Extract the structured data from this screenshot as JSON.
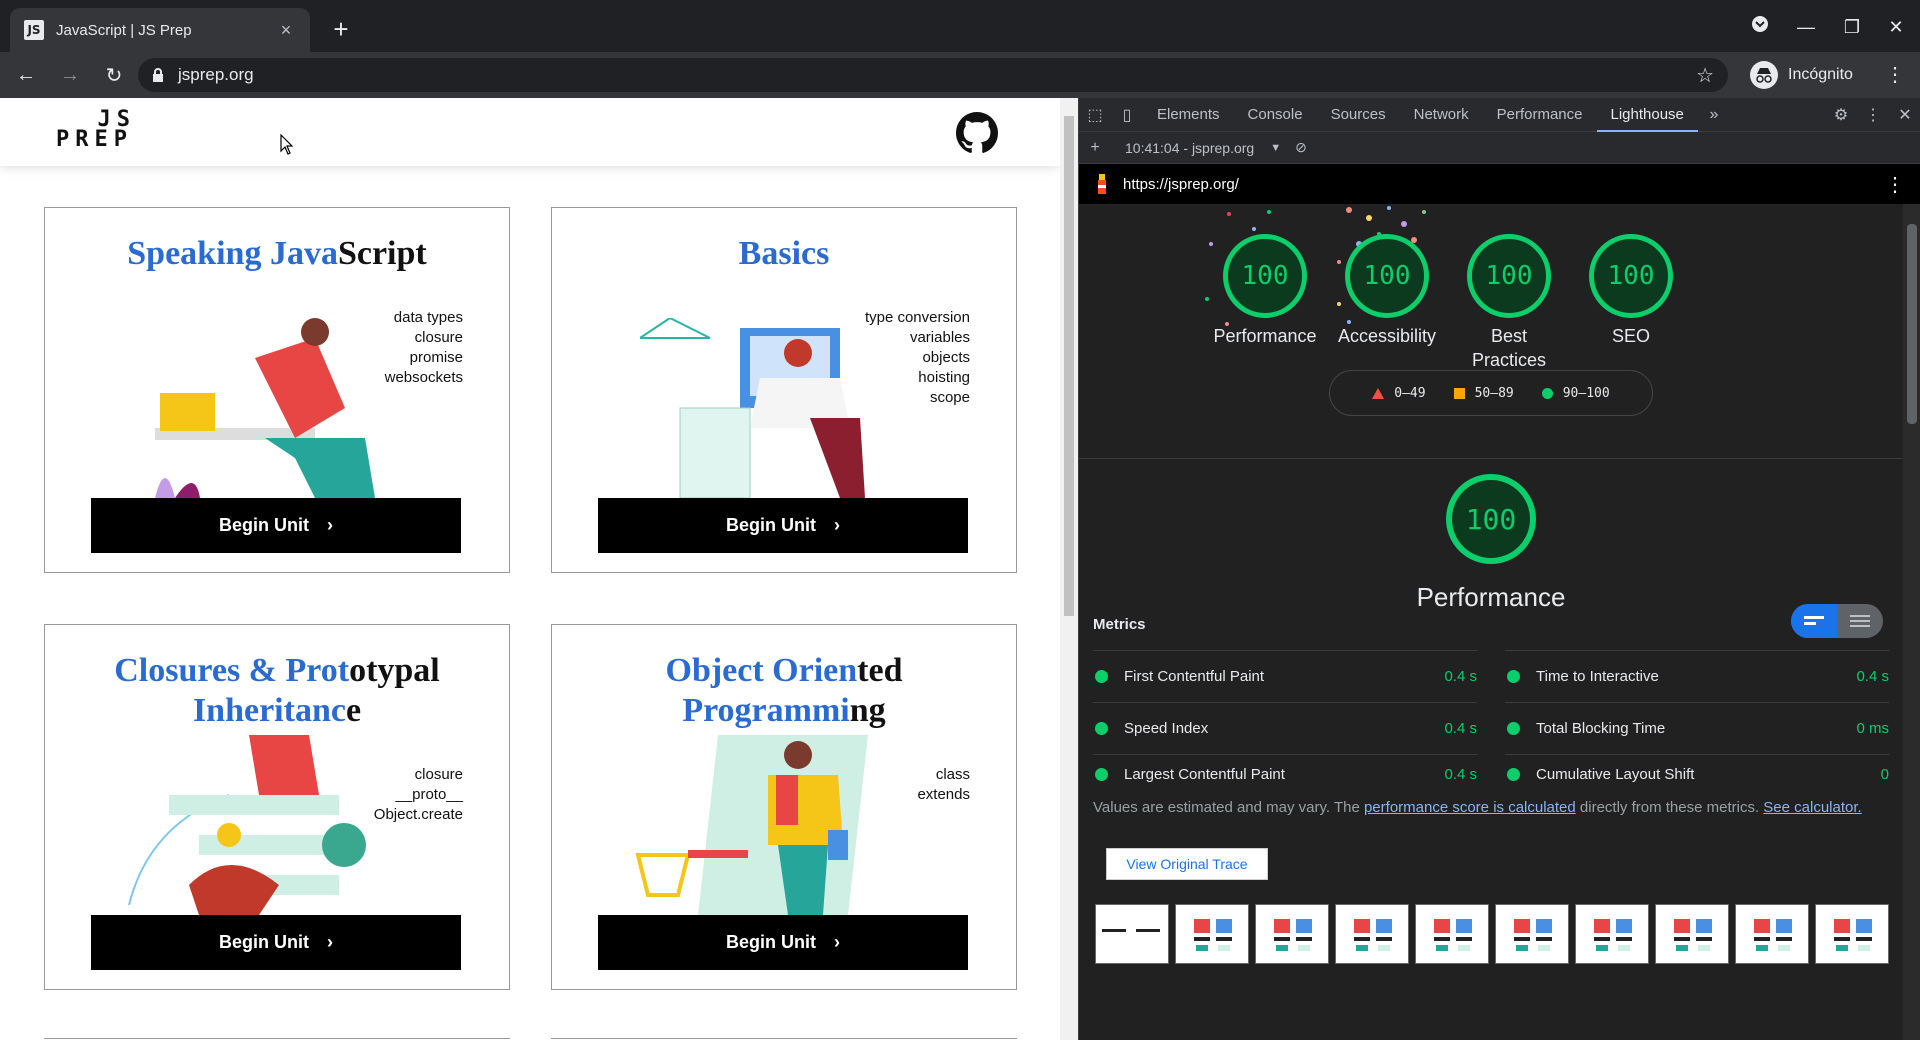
{
  "browser": {
    "tab_title": "JavaScript | JS Prep",
    "favicon_text": "JS",
    "new_tab_label": "+",
    "url": "jsprep.org",
    "profile_label": "Incógnito"
  },
  "site": {
    "logo_line1": "JS",
    "logo_line2": "PREP",
    "cards": [
      {
        "title_blue": "Speaking Java",
        "title_black": "Script",
        "topics": [
          "data types",
          "closure",
          "promise",
          "websockets"
        ],
        "button": "Begin Unit"
      },
      {
        "title_blue": "Basics",
        "title_black": "",
        "topics": [
          "type conversion",
          "variables",
          "objects",
          "hoisting",
          "scope"
        ],
        "button": "Begin Unit"
      },
      {
        "title_blue": "Closures & Prot",
        "title_black": "otypal",
        "title2_blue": "Inheritanc",
        "title2_black": "e",
        "topics": [
          "closure",
          "__proto__",
          "Object.create"
        ],
        "button": "Begin Unit"
      },
      {
        "title_blue": "Object Orien",
        "title_black": "ted",
        "title2_blue": "Programmi",
        "title2_black": "ng",
        "topics": [
          "class",
          "extends"
        ],
        "button": "Begin Unit"
      }
    ]
  },
  "devtools": {
    "tabs": [
      "Elements",
      "Console",
      "Sources",
      "Network",
      "Performance",
      "Lighthouse"
    ],
    "active_tab": "Lighthouse",
    "report_selector": "10:41:04 - jsprep.org",
    "report_url": "https://jsprep.org/",
    "gauges": [
      {
        "score": "100",
        "label": "Performance"
      },
      {
        "score": "100",
        "label": "Accessibility"
      },
      {
        "score": "100",
        "label": "Best Practices"
      },
      {
        "score": "100",
        "label": "SEO"
      }
    ],
    "legend": {
      "fail": "0–49",
      "average": "50–89",
      "pass": "90–100"
    },
    "main_score": "100",
    "main_label": "Performance",
    "metrics_title": "Metrics",
    "metrics": [
      {
        "name": "First Contentful Paint",
        "value": "0.4 s"
      },
      {
        "name": "Time to Interactive",
        "value": "0.4 s"
      },
      {
        "name": "Speed Index",
        "value": "0.4 s"
      },
      {
        "name": "Total Blocking Time",
        "value": "0 ms"
      },
      {
        "name": "Largest Contentful Paint",
        "value": "0.4 s"
      },
      {
        "name": "Cumulative Layout Shift",
        "value": "0"
      }
    ],
    "note_prefix": "Values are estimated and may vary. The ",
    "note_link1": "performance score is calculated",
    "note_middle": " directly from these metrics. ",
    "note_link2": "See calculator.",
    "trace_button": "View Original Trace",
    "colors": {
      "pass": "#0cce6b",
      "average": "#ffa400",
      "fail": "#ff4e42"
    }
  }
}
